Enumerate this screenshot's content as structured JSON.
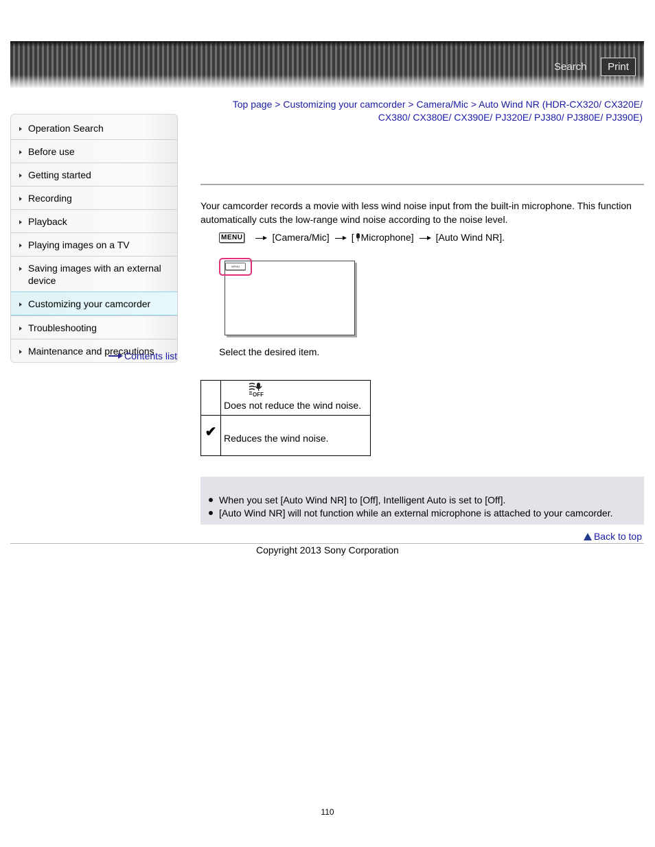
{
  "header": {
    "search_label": "Search",
    "print_label": "Print"
  },
  "breadcrumb": {
    "items": [
      "Top page",
      "Customizing your camcorder",
      "Camera/Mic",
      "Auto Wind NR (HDR-CX320/ CX320E/ CX380/ CX380E/ CX390E/ PJ320E/ PJ380/ PJ380E/ PJ390E)"
    ],
    "separator": " > "
  },
  "sidebar": {
    "items": [
      {
        "label": "Operation Search",
        "active": false
      },
      {
        "label": "Before use",
        "active": false
      },
      {
        "label": "Getting started",
        "active": false
      },
      {
        "label": "Recording",
        "active": false
      },
      {
        "label": "Playback",
        "active": false
      },
      {
        "label": "Playing images on a TV",
        "active": false
      },
      {
        "label": "Saving images with an external device",
        "active": false
      },
      {
        "label": "Customizing your camcorder",
        "active": true
      },
      {
        "label": "Troubleshooting",
        "active": false
      },
      {
        "label": "Maintenance and precautions",
        "active": false
      }
    ],
    "contents_link": "Contents list",
    "active_color": "#dff3f6"
  },
  "main": {
    "intro": "Your camcorder records a movie with less wind noise input from the built-in microphone. This function automatically cuts the low-range wind noise according to the noise level.",
    "menu_path": {
      "menu_key": "MENU",
      "steps": [
        "[Camera/Mic]",
        "[",
        "Microphone]",
        "[Auto Wind NR]."
      ]
    },
    "illustration": {
      "menu_button": "MENU",
      "highlight_color": "#e0307a"
    },
    "step_text": "Select the desired item.",
    "options": [
      {
        "icon": "wind-noise-off-icon",
        "description": "Does not reduce the wind noise."
      },
      {
        "icon": "checkmark-icon",
        "check_glyph": "✔",
        "description": "Reduces the wind noise."
      }
    ],
    "notes": [
      "When you set [Auto Wind NR] to [Off], Intelligent Auto is set to [Off].",
      "[Auto Wind NR] will not function while an external microphone is attached to your camcorder."
    ]
  },
  "footer": {
    "back_to_top": "Back to top",
    "copyright": "Copyright 2013 Sony Corporation",
    "page_number": "110"
  },
  "colors": {
    "link": "#1a1aa6",
    "note_bg": "#e1e3e8"
  }
}
